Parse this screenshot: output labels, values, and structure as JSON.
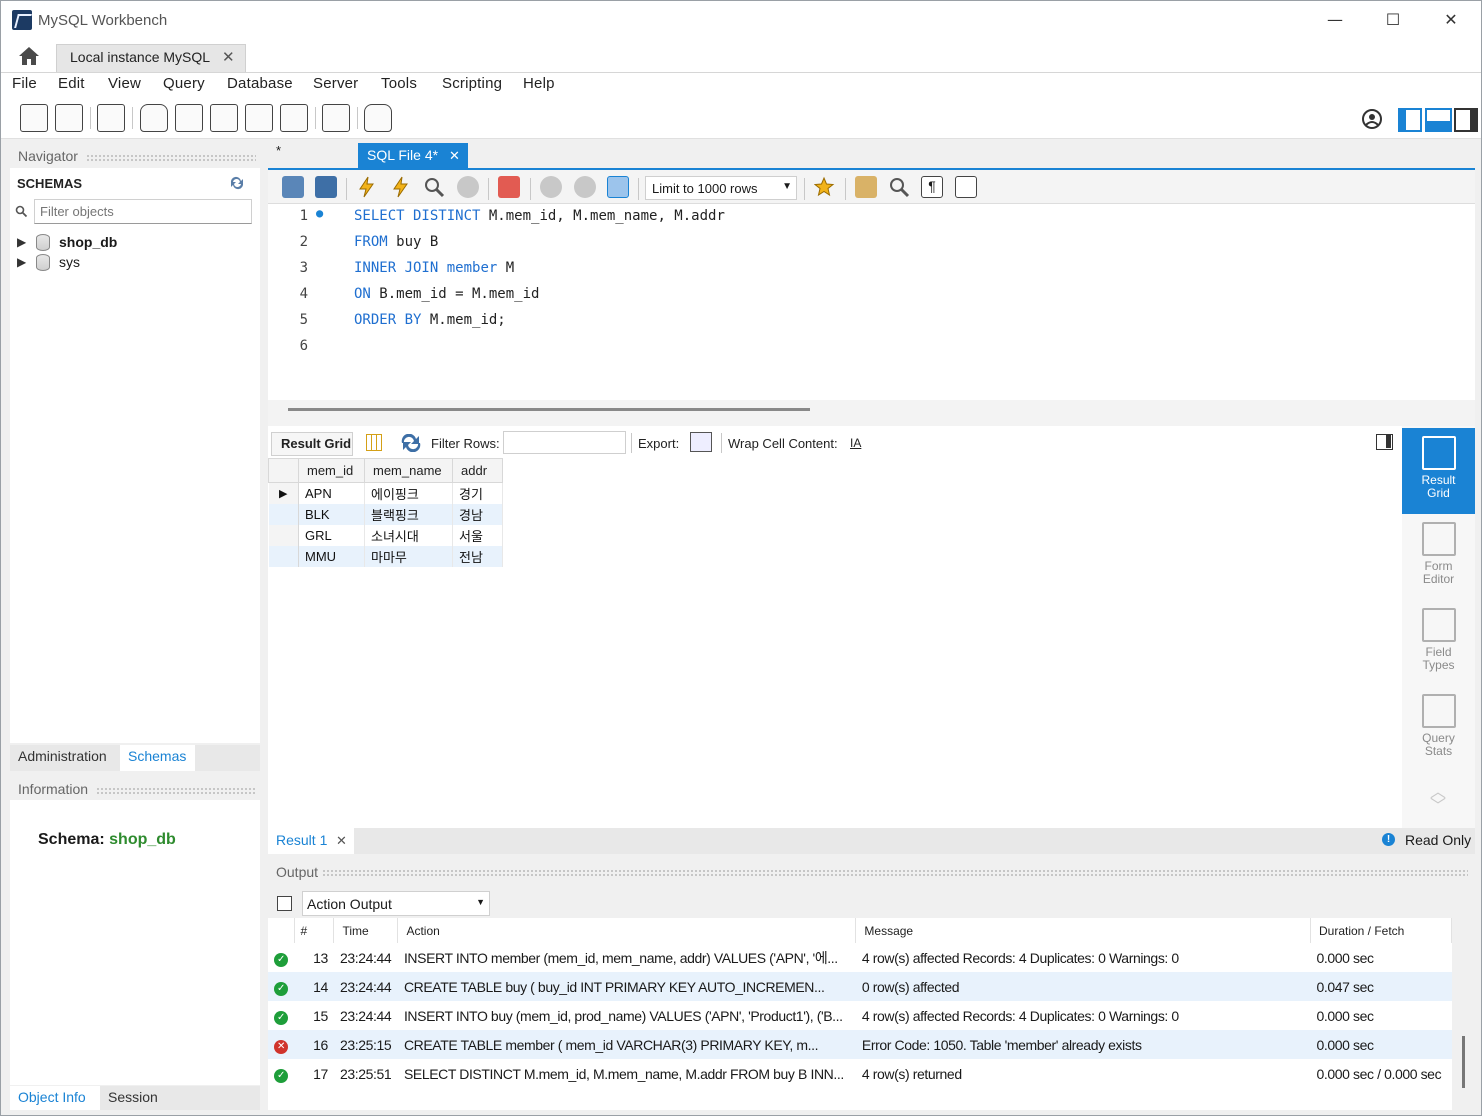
{
  "window": {
    "title": "MySQL Workbench",
    "minimize": "—",
    "maximize": "☐",
    "close": "✕"
  },
  "connection_tab": {
    "label": "Local instance MySQL",
    "close": "✕"
  },
  "menu": [
    "File",
    "Edit",
    "View",
    "Query",
    "Database",
    "Server",
    "Tools",
    "Scripting",
    "Help"
  ],
  "navigator": {
    "title": "Navigator",
    "schemas_title": "SCHEMAS",
    "filter_placeholder": "Filter objects",
    "schemas": [
      {
        "name": "shop_db",
        "bold": true
      },
      {
        "name": "sys",
        "bold": false
      }
    ],
    "tabs": [
      "Administration",
      "Schemas"
    ]
  },
  "information": {
    "title": "Information",
    "schema_label": "Schema:",
    "schema_value": "shop_db",
    "tabs": [
      "Object Info",
      "Session"
    ]
  },
  "editor": {
    "star": "*",
    "tab_label": "SQL File 4*",
    "tab_close": "✕",
    "limit_label": "Limit to 1000 rows",
    "lines": [
      {
        "num": "1",
        "marker": "●",
        "parts": [
          {
            "t": "SELECT DISTINCT",
            "k": true
          },
          {
            "t": " M.mem_id, M.mem_name, M.addr",
            "k": false
          }
        ]
      },
      {
        "num": "2",
        "marker": "",
        "parts": [
          {
            "t": "FROM",
            "k": true
          },
          {
            "t": " buy B",
            "k": false
          }
        ]
      },
      {
        "num": "3",
        "marker": "",
        "parts": [
          {
            "t": "INNER JOIN",
            "k": true
          },
          {
            "t": " ",
            "k": false
          },
          {
            "t": "member",
            "k": true
          },
          {
            "t": " M",
            "k": false
          }
        ]
      },
      {
        "num": "4",
        "marker": "",
        "parts": [
          {
            "t": "ON",
            "k": true
          },
          {
            "t": " B.mem_id = M.mem_id",
            "k": false
          }
        ]
      },
      {
        "num": "5",
        "marker": "",
        "parts": [
          {
            "t": "ORDER BY",
            "k": true
          },
          {
            "t": " M.mem_id;",
            "k": false
          }
        ]
      },
      {
        "num": "6",
        "marker": "",
        "parts": []
      }
    ]
  },
  "result_toolbar": {
    "result_grid": "Result Grid",
    "filter_rows": "Filter Rows:",
    "export": "Export:",
    "wrap": "Wrap Cell Content:",
    "wrap_icon": "IA"
  },
  "result_grid": {
    "columns": [
      "mem_id",
      "mem_name",
      "addr"
    ],
    "rows": [
      [
        "APN",
        "에이핑크",
        "경기"
      ],
      [
        "BLK",
        "블랙핑크",
        "경남"
      ],
      [
        "GRL",
        "소녀시대",
        "서울"
      ],
      [
        "MMU",
        "마마무",
        "전남"
      ]
    ]
  },
  "side_panel": [
    {
      "label1": "Result",
      "label2": "Grid",
      "active": true
    },
    {
      "label1": "Form",
      "label2": "Editor",
      "active": false
    },
    {
      "label1": "Field",
      "label2": "Types",
      "active": false
    },
    {
      "label1": "Query",
      "label2": "Stats",
      "active": false
    }
  ],
  "result_tab": {
    "label": "Result 1",
    "close": "✕",
    "read_only": "Read Only"
  },
  "output": {
    "title": "Output",
    "selector": "Action Output",
    "columns": [
      "#",
      "Time",
      "Action",
      "Message",
      "Duration / Fetch"
    ],
    "rows": [
      {
        "status": "ok",
        "num": "13",
        "time": "23:24:44",
        "action": "INSERT INTO member (mem_id, mem_name, addr) VALUES ('APN', '에...",
        "message": "4 row(s) affected Records: 4  Duplicates: 0  Warnings: 0",
        "duration": "0.000 sec"
      },
      {
        "status": "ok",
        "num": "14",
        "time": "23:24:44",
        "action": "CREATE TABLE buy (     buy_id INT PRIMARY KEY AUTO_INCREMEN...",
        "message": "0 row(s) affected",
        "duration": "0.047 sec"
      },
      {
        "status": "ok",
        "num": "15",
        "time": "23:24:44",
        "action": "INSERT INTO buy (mem_id, prod_name) VALUES ('APN', 'Product1'), ('B...",
        "message": "4 row(s) affected Records: 4  Duplicates: 0  Warnings: 0",
        "duration": "0.000 sec"
      },
      {
        "status": "err",
        "num": "16",
        "time": "23:25:15",
        "action": "CREATE TABLE member (     mem_id VARCHAR(3) PRIMARY KEY,     m...",
        "message": "Error Code: 1050. Table 'member' already exists",
        "duration": "0.000 sec"
      },
      {
        "status": "ok",
        "num": "17",
        "time": "23:25:51",
        "action": "SELECT DISTINCT M.mem_id, M.mem_name, M.addr FROM buy B INN...",
        "message": "4 row(s) returned",
        "duration": "0.000 sec / 0.000 sec"
      }
    ]
  },
  "colors": {
    "accent": "#1a83d4",
    "keyword": "#1f6fd0",
    "ok": "#1e9e3a",
    "error": "#d0342c",
    "schema_green": "#2e8b2e"
  }
}
